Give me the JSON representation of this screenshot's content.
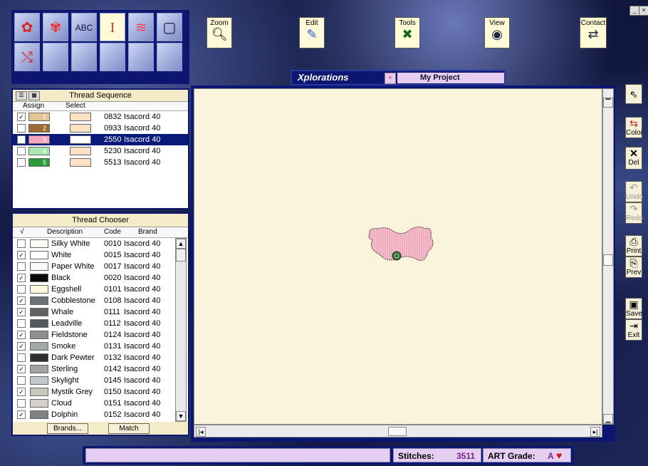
{
  "toolbar": {
    "zoom_label": "Zoom",
    "edit_label": "Edit",
    "tools_label": "Tools",
    "view_label": "View",
    "contact_label": "Contact"
  },
  "project_tab": {
    "app_name": "Xplorations",
    "project_name": "My Project"
  },
  "thread_sequence": {
    "title": "Thread Sequence",
    "col_assign": "Assign",
    "col_select": "Select",
    "rows": [
      {
        "num": "1",
        "code": "0832",
        "brand": "Isacord 40",
        "checked": "✓",
        "color": "#e3c693"
      },
      {
        "num": "2",
        "code": "0933",
        "brand": "Isacord 40",
        "checked": "",
        "color": "#a06a35"
      },
      {
        "num": "3",
        "code": "2550",
        "brand": "Isacord 40",
        "checked": "✓",
        "color": "#f4a8bf"
      },
      {
        "num": "4",
        "code": "5230",
        "brand": "Isacord 40",
        "checked": "",
        "color": "#a9e8b0"
      },
      {
        "num": "5",
        "code": "5513",
        "brand": "Isacord 40",
        "checked": "",
        "color": "#2c9a3c"
      }
    ]
  },
  "thread_chooser": {
    "title": "Thread Chooser",
    "col_check": "√",
    "col_description": "Description",
    "col_code": "Code",
    "col_brand": "Brand",
    "brands_button": "Brands...",
    "match_button": "Match",
    "rows": [
      {
        "desc": "Silky White",
        "code": "0010",
        "brand": "Isacord 40",
        "checked": "",
        "color": "#fcfcf4"
      },
      {
        "desc": "White",
        "code": "0015",
        "brand": "Isacord 40",
        "checked": "✓",
        "color": "#ffffff"
      },
      {
        "desc": "Paper White",
        "code": "0017",
        "brand": "Isacord 40",
        "checked": "",
        "color": "#fafafa"
      },
      {
        "desc": "Black",
        "code": "0020",
        "brand": "Isacord 40",
        "checked": "✓",
        "color": "#0a0a0a"
      },
      {
        "desc": "Eggshell",
        "code": "0101",
        "brand": "Isacord 40",
        "checked": "",
        "color": "#fcf8dc"
      },
      {
        "desc": "Cobblestone",
        "code": "0108",
        "brand": "Isacord 40",
        "checked": "✓",
        "color": "#6e7274"
      },
      {
        "desc": "Whale",
        "code": "0111",
        "brand": "Isacord 40",
        "checked": "✓",
        "color": "#5e6266"
      },
      {
        "desc": "Leadville",
        "code": "0112",
        "brand": "Isacord 40",
        "checked": "",
        "color": "#55585c"
      },
      {
        "desc": "Fieldstone",
        "code": "0124",
        "brand": "Isacord 40",
        "checked": "✓",
        "color": "#8c9090"
      },
      {
        "desc": "Smoke",
        "code": "0131",
        "brand": "Isacord 40",
        "checked": "✓",
        "color": "#a4a8aa"
      },
      {
        "desc": "Dark Pewter",
        "code": "0132",
        "brand": "Isacord 40",
        "checked": "",
        "color": "#2e3030"
      },
      {
        "desc": "Sterling",
        "code": "0142",
        "brand": "Isacord 40",
        "checked": "✓",
        "color": "#a0a4a4"
      },
      {
        "desc": "Skylight",
        "code": "0145",
        "brand": "Isacord 40",
        "checked": "",
        "color": "#c4c8ca"
      },
      {
        "desc": "Mystik Grey",
        "code": "0150",
        "brand": "Isacord 40",
        "checked": "✓",
        "color": "#c6c8b8"
      },
      {
        "desc": "Cloud",
        "code": "0151",
        "brand": "Isacord 40",
        "checked": "",
        "color": "#d4cfc8"
      },
      {
        "desc": "Dolphin",
        "code": "0152",
        "brand": "Isacord 40",
        "checked": "✓",
        "color": "#7e8284"
      }
    ]
  },
  "right_tools": {
    "color_label": "Color",
    "del_label": "Del",
    "undo_label": "Undo",
    "redo_label": "Redo",
    "print_label": "Print",
    "prev_label": "Prev",
    "save_label": "Save",
    "exit_label": "Exit"
  },
  "status": {
    "stitches_label": "Stitches:",
    "stitches_value": "3511",
    "art_grade_label": "ART Grade:",
    "art_grade_value": "A",
    "heart": "♥"
  }
}
